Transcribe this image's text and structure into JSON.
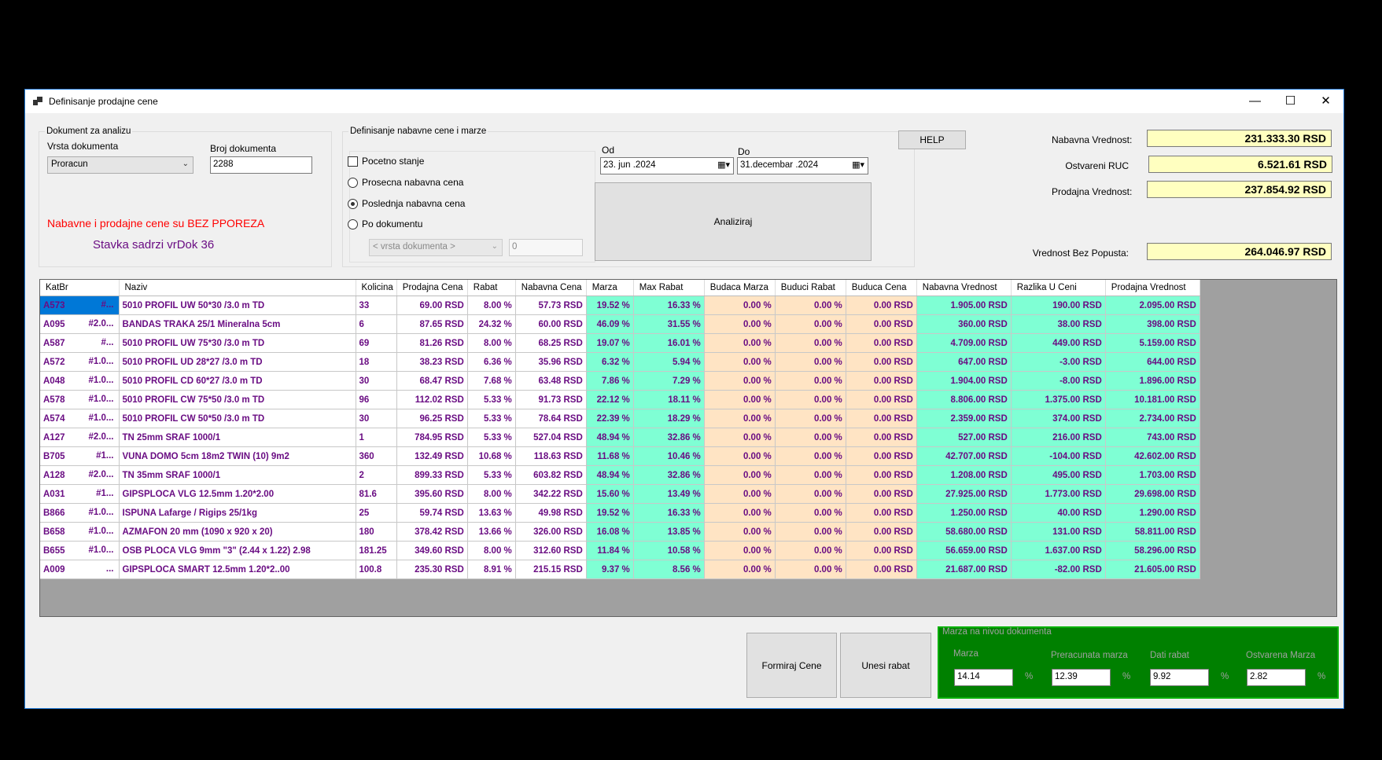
{
  "window": {
    "title": "Definisanje prodajne cene",
    "minimize_glyph": "—",
    "maximize_glyph": "☐",
    "close_glyph": "✕"
  },
  "doc_group": {
    "legend": "Dokument za analizu",
    "vrsta_label": "Vrsta dokumenta",
    "vrsta_value": "Proracun",
    "broj_label": "Broj dokumenta",
    "broj_value": "2288",
    "warning": "Nabavne i prodajne cene su BEZ PPOREZA",
    "stavka": "Stavka sadrzi vrDok 36",
    "warning_color": "#ff0000",
    "stavka_color": "#6a0d83"
  },
  "nab_group": {
    "legend": "Definisanje nabavne cene i marze",
    "pocetno_stanje": {
      "label": "Pocetno stanje",
      "checked": false
    },
    "options": [
      {
        "label": "Prosecna nabavna cena",
        "selected": false
      },
      {
        "label": "Poslednja nabavna cena",
        "selected": true
      },
      {
        "label": "Po dokumentu",
        "selected": false
      }
    ],
    "vrsta_dokumenta_placeholder": "< vrsta dokumenta >",
    "doc_number": "0",
    "od_label": "Od",
    "do_label": "Do",
    "od_value": "23.     jun     .2024",
    "do_value": "31.decembar .2024",
    "analiziraj": "Analiziraj"
  },
  "help_button": "HELP",
  "summary": {
    "nabavna_label": "Nabavna Vrednost:",
    "nabavna_value": "231.333.30 RSD",
    "ruc_label": "Ostvareni RUC",
    "ruc_value": "6.521.61 RSD",
    "prodajna_label": "Prodajna Vrednost:",
    "prodajna_value": "237.854.92 RSD",
    "bez_popusta_label": "Vrednost Bez Popusta:",
    "bez_popusta_value": "264.046.97 RSD"
  },
  "table": {
    "columns": [
      "KatBr",
      "Naziv",
      "Kolicina",
      "Prodajna Cena",
      "Rabat",
      "Nabavna Cena",
      "Marza",
      "Max Rabat",
      "Budaca Marza",
      "Buduci Rabat",
      "Buduca Cena",
      "Nabavna Vrednost",
      "Razlika U Ceni",
      "Prodajna Vrednost"
    ],
    "rows": [
      [
        "A573",
        "#...",
        "5010   PROFIL  UW   50*30 /3.0 m  TD",
        "33",
        "69.00 RSD",
        "8.00 %",
        "57.73 RSD",
        "19.52 %",
        "16.33 %",
        "0.00 %",
        "0.00 %",
        "0.00 RSD",
        "1.905.00 RSD",
        "190.00 RSD",
        "2.095.00 RSD"
      ],
      [
        "A095",
        "#2.0...",
        "BANDAS TRAKA 25/1  Mineralna     5cm",
        "6",
        "87.65 RSD",
        "24.32 %",
        "60.00 RSD",
        "46.09 %",
        "31.55 %",
        "0.00 %",
        "0.00 %",
        "0.00 RSD",
        "360.00 RSD",
        "38.00 RSD",
        "398.00 RSD"
      ],
      [
        "A587",
        "#...",
        "5010   PROFIL  UW  75*30 /3.0 m  TD",
        "69",
        "81.26 RSD",
        "8.00 %",
        "68.25 RSD",
        "19.07 %",
        "16.01 %",
        "0.00 %",
        "0.00 %",
        "0.00 RSD",
        "4.709.00 RSD",
        "449.00 RSD",
        "5.159.00 RSD"
      ],
      [
        "A572",
        "#1.0...",
        "5010   PROFIL   UD 28*27 /3.0 m  TD",
        "18",
        "38.23 RSD",
        "6.36 %",
        "35.96 RSD",
        "6.32 %",
        "5.94 %",
        "0.00 %",
        "0.00 %",
        "0.00 RSD",
        "647.00 RSD",
        "-3.00 RSD",
        "644.00 RSD"
      ],
      [
        "A048",
        "#1.0...",
        "5010   PROFIL  CD 60*27 /3.0 m  TD",
        "30",
        "68.47 RSD",
        "7.68 %",
        "63.48 RSD",
        "7.86 %",
        "7.29 %",
        "0.00 %",
        "0.00 %",
        "0.00 RSD",
        "1.904.00 RSD",
        "-8.00 RSD",
        "1.896.00 RSD"
      ],
      [
        "A578",
        "#1.0...",
        "5010   PROFIL  CW  75*50 /3.0 m  TD",
        "96",
        "112.02 RSD",
        "5.33 %",
        "91.73 RSD",
        "22.12 %",
        "18.11 %",
        "0.00 %",
        "0.00 %",
        "0.00 RSD",
        "8.806.00 RSD",
        "1.375.00 RSD",
        "10.181.00 RSD"
      ],
      [
        "A574",
        "#1.0...",
        "5010   PROFIL  CW  50*50 /3.0 m  TD",
        "30",
        "96.25 RSD",
        "5.33 %",
        "78.64 RSD",
        "22.39 %",
        "18.29 %",
        "0.00 %",
        "0.00 %",
        "0.00 RSD",
        "2.359.00 RSD",
        "374.00 RSD",
        "2.734.00 RSD"
      ],
      [
        "A127",
        "#2.0...",
        "TN 25mm  SRAF  1000/1",
        "1",
        "784.95 RSD",
        "5.33 %",
        "527.04 RSD",
        "48.94 %",
        "32.86 %",
        "0.00 %",
        "0.00 %",
        "0.00 RSD",
        "527.00 RSD",
        "216.00 RSD",
        "743.00 RSD"
      ],
      [
        "B705",
        "#1...",
        "VUNA    DOMO   5cm  18m2   TWIN       (10)  9m2",
        "360",
        "132.49 RSD",
        "10.68 %",
        "118.63 RSD",
        "11.68 %",
        "10.46 %",
        "0.00 %",
        "0.00 %",
        "0.00 RSD",
        "42.707.00 RSD",
        "-104.00 RSD",
        "42.602.00 RSD"
      ],
      [
        "A128",
        "#2.0...",
        "TN 35mm  SRAF  1000/1",
        "2",
        "899.33 RSD",
        "5.33 %",
        "603.82 RSD",
        "48.94 %",
        "32.86 %",
        "0.00 %",
        "0.00 %",
        "0.00 RSD",
        "1.208.00 RSD",
        "495.00 RSD",
        "1.703.00 RSD"
      ],
      [
        "A031",
        "#1...",
        "GIPSPLOCA  VLG 12.5mm  1.20*2.00",
        "81.6",
        "395.60 RSD",
        "8.00 %",
        "342.22 RSD",
        "15.60 %",
        "13.49 %",
        "0.00 %",
        "0.00 %",
        "0.00 RSD",
        "27.925.00 RSD",
        "1.773.00 RSD",
        "29.698.00 RSD"
      ],
      [
        "B866",
        "#1.0...",
        "ISPUNA  Lafarge / Rigips  25/1kg",
        "25",
        "59.74 RSD",
        "13.63 %",
        "49.98 RSD",
        "19.52 %",
        "16.33 %",
        "0.00 %",
        "0.00 %",
        "0.00 RSD",
        "1.250.00 RSD",
        "40.00 RSD",
        "1.290.00 RSD"
      ],
      [
        "B658",
        "#1.0...",
        "AZMAFON   20 mm  (1090 x 920 x 20)",
        "180",
        "378.42 RSD",
        "13.66 %",
        "326.00 RSD",
        "16.08 %",
        "13.85 %",
        "0.00 %",
        "0.00 %",
        "0.00 RSD",
        "58.680.00 RSD",
        "131.00 RSD",
        "58.811.00 RSD"
      ],
      [
        "B655",
        "#1.0...",
        "OSB  PLOCA VLG   9mm   \"3\"  (2.44 x 1.22) 2.98",
        "181.25",
        "349.60 RSD",
        "8.00 %",
        "312.60 RSD",
        "11.84 %",
        "10.58 %",
        "0.00 %",
        "0.00 %",
        "0.00 RSD",
        "56.659.00 RSD",
        "1.637.00 RSD",
        "58.296.00 RSD"
      ],
      [
        "A009",
        "...",
        "GIPSPLOCA  SMART  12.5mm  1.20*2..00",
        "100.8",
        "235.30 RSD",
        "8.91 %",
        "215.15 RSD",
        "9.37 %",
        "8.56 %",
        "0.00 %",
        "0.00 %",
        "0.00 RSD",
        "21.687.00 RSD",
        "-82.00 RSD",
        "21.605.00 RSD"
      ]
    ]
  },
  "buttons": {
    "formiraj": "Formiraj Cene",
    "unesi": "Unesi rabat"
  },
  "marza_group": {
    "legend": "Marza na nivou dokumenta",
    "marza_label": "Marza",
    "marza_value": "14.14",
    "preracunata_label": "Preracunata marza",
    "preracunata_value": "12.39",
    "dati_label": "Dati rabat",
    "dati_value": "9.92",
    "ostvarena_label": "Ostvarena Marza",
    "ostvarena_value": "2.82",
    "pct": "%"
  },
  "colors": {
    "accent": "#0078d7",
    "row_text": "#6a0d83",
    "margin_cells": "#7fffd4",
    "future_cells": "#ffe4c4",
    "summary_fields": "#ffffc0",
    "document_margin_panel": "#008000"
  }
}
